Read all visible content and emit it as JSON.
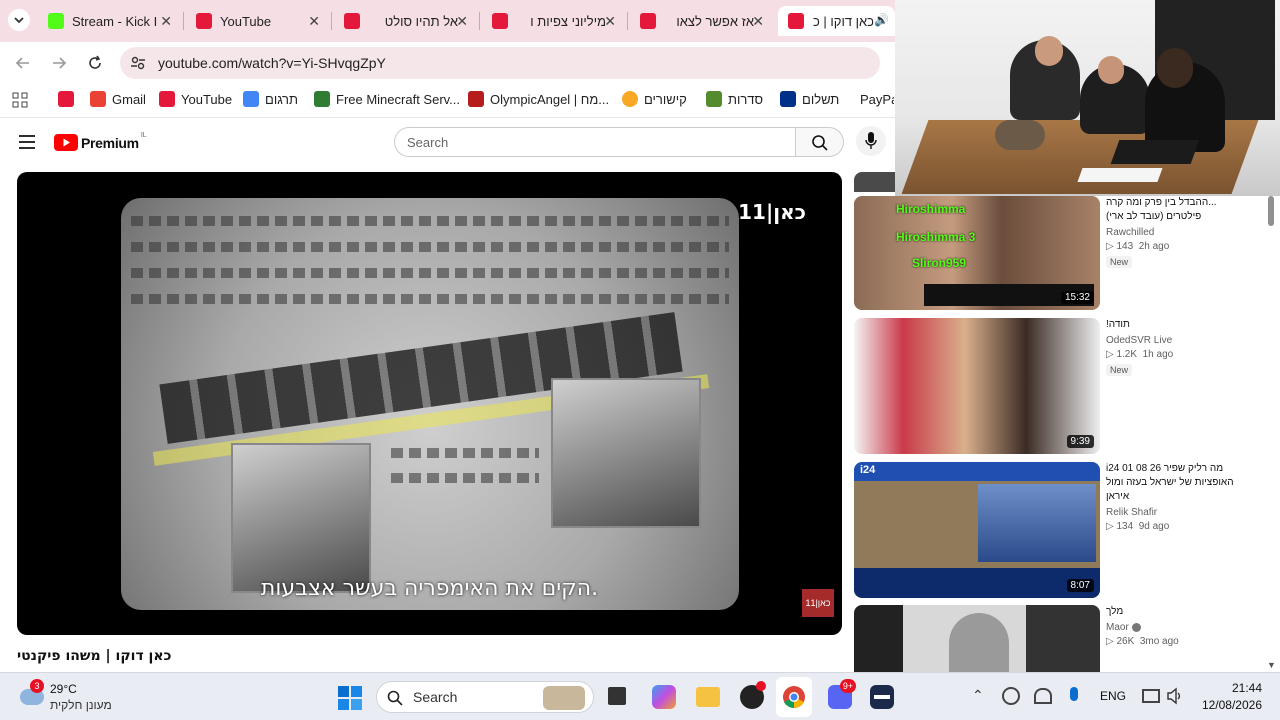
{
  "browser": {
    "tabs": [
      {
        "title": "Stream - Kick I",
        "color": "#53fc18"
      },
      {
        "title": "YouTube",
        "color": "#ff0000"
      },
      {
        "title": "אל תהיו סולט",
        "color": "#ff0000"
      },
      {
        "title": "מיליוני צפיות ו",
        "color": "#ff0000"
      },
      {
        "title": "אז אפשר לצאו",
        "color": "#ff0000"
      },
      {
        "title": "כאן דוקו | כ",
        "color": "#ff0000"
      }
    ],
    "url": "youtube.com/watch?v=Yi-SHvqgZpY",
    "bookmarks": [
      {
        "label": "Gmail",
        "color": "#ea4335"
      },
      {
        "label": "YouTube",
        "color": "#ff0000"
      },
      {
        "label": "תרגום",
        "color": "#4285f4"
      },
      {
        "label": "Free Minecraft Serv...",
        "color": "#2e7d32"
      },
      {
        "label": "OlympicAngel | מח...",
        "color": "#b71c1c"
      },
      {
        "label": "קישורים",
        "color": "#f9a825"
      },
      {
        "label": "סדרות",
        "color": "#558b2f"
      },
      {
        "label": "תשלום",
        "color": "#003087"
      },
      {
        "label": "PayPal",
        "color": "#003087"
      }
    ]
  },
  "youtube": {
    "logo_text": "Premium",
    "logo_region": "IL",
    "search_placeholder": "Search",
    "player": {
      "channel_logo": "כאן|11",
      "subtitle": "הקים את האימפריה בעשר אצבעות.",
      "corner_logo": "כאן|11"
    },
    "video_title": "כאן דוקו | משהו פיקנטי",
    "recommendations": [
      {
        "title_line1": "...ההבדל בין פרק ומה קרה",
        "title_line2": "פילטרים (עובד לב ארי)",
        "channel": "Rawchilled",
        "views": "143",
        "age": "2h ago",
        "badge": "New",
        "duration": "15:32",
        "chat": [
          "Hiroshimma",
          "Hiroshimma 3",
          "Sliron959"
        ]
      },
      {
        "title_line1": "תודה!",
        "title_line2": "",
        "channel": "OdedSVR Live",
        "views": "1.2K",
        "age": "1h ago",
        "badge": "New",
        "duration": "9:39"
      },
      {
        "title_line1": "i24  01 08 26  מה  רליק שפיר",
        "title_line2": "האופציות של ישראל בעזה ומול",
        "title_line3": "איראן",
        "channel": "Relik Shafir",
        "views": "134",
        "age": "9d ago",
        "badge": "",
        "duration": "8:07"
      },
      {
        "title_line1": "מלך",
        "title_line2": "",
        "channel": "Maor",
        "views": "26K",
        "age": "3mo ago",
        "badge": "",
        "duration": ""
      }
    ]
  },
  "taskbar": {
    "weather_badge": "3",
    "temperature": "29°C",
    "weather_desc": "מעונן חלקית",
    "search_label": "Search",
    "discord_badge": "9+",
    "language": "ENG",
    "time": "21:44",
    "date": "12/08/2026"
  },
  "icons": [
    "tab-menu-icon",
    "back-icon",
    "forward-icon",
    "reload-icon",
    "site-info-icon",
    "apps-icon",
    "hamburger-icon",
    "youtube-logo-icon",
    "search-icon",
    "mic-icon",
    "windows-start-icon",
    "chrome-icon",
    "discord-icon",
    "wifi-icon",
    "volume-icon"
  ]
}
